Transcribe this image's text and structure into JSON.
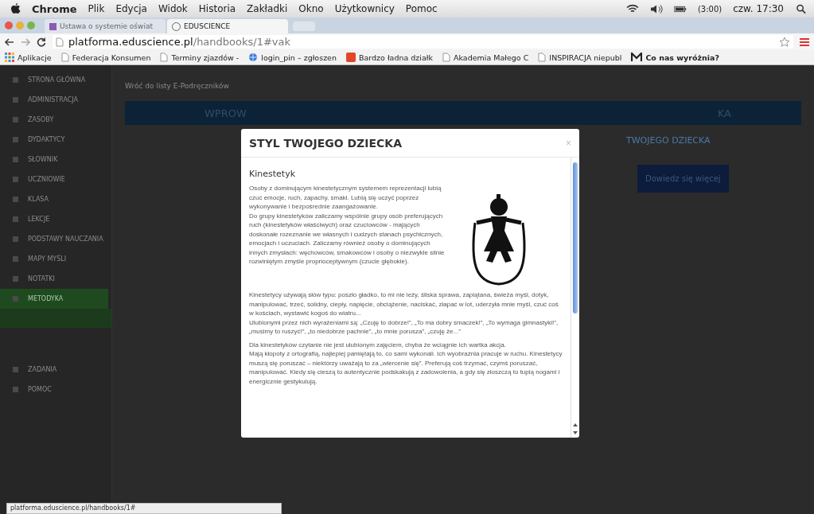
{
  "menu_bar": {
    "app": "Chrome",
    "items": [
      "Plik",
      "Edycja",
      "Widok",
      "Historia",
      "Zakładki",
      "Okno",
      "Użytkownicy",
      "Pomoc"
    ],
    "battery_time": "(3:00)",
    "clock": "czw. 17:30"
  },
  "tabs": [
    {
      "label": "Ustawa o systemie oświat",
      "selected": false
    },
    {
      "label": "EDUSCIENCE",
      "selected": true
    }
  ],
  "address_bar": {
    "host": "platforma.eduscience.pl",
    "path": "/handbooks/1#vak"
  },
  "bookmarks": [
    {
      "label": "Aplikacje",
      "kind": "apps"
    },
    {
      "label": "Federacja Konsumen",
      "kind": "page"
    },
    {
      "label": "Terminy zjazdów -",
      "kind": "page"
    },
    {
      "label": "login_pin – zgłoszen",
      "kind": "globe"
    },
    {
      "label": "Bardzo ładna działk",
      "kind": "flag"
    },
    {
      "label": "Akademia Małego C",
      "kind": "page"
    },
    {
      "label": "INSPIRACJA niepubl",
      "kind": "page"
    },
    {
      "label": "Co nas wyróżnia?",
      "kind": "logo"
    }
  ],
  "sidebar": {
    "items": [
      {
        "label": "STRONA GŁÓWNA",
        "selected": false
      },
      {
        "label": "ADMINISTRACJA",
        "selected": false
      },
      {
        "label": "ZASOBY",
        "selected": false
      },
      {
        "label": "DYDAKTYCY",
        "selected": false
      },
      {
        "label": "SŁOWNIK",
        "selected": false
      },
      {
        "label": "UCZNIOWIE",
        "selected": false
      },
      {
        "label": "KLASA",
        "selected": false
      },
      {
        "label": "LEKCJE",
        "selected": false
      },
      {
        "label": "PODSTAWY NAUCZANIA",
        "selected": false
      },
      {
        "label": "MAPY MYŚLI",
        "selected": false
      },
      {
        "label": "NOTATKI",
        "selected": false
      },
      {
        "label": "METODYKA",
        "selected": true
      }
    ],
    "bottom_items": [
      {
        "label": "ZADANIA"
      },
      {
        "label": "POMOC"
      }
    ]
  },
  "page": {
    "back_link": "Wróć do listy E-Podręczników",
    "banner_left": "WPROW",
    "banner_right": "KA",
    "side_heading": "TWOJEGO DZIECKA",
    "more_button": "Dowiedz się więcej"
  },
  "modal": {
    "title": "STYL TWOJEGO DZIECKA",
    "close": "×",
    "heading": "Kinestetyk",
    "intro": [
      "Osoby z dominującym kinestetycznym systemem reprezentacji lubią czuć emocje, ruch, zapachy, smaki. Lubią się uczyć poprzez wykonywanie i bezpośrednie zaangażowanie.",
      "Do grupy kinestetyków zaliczamy wspólnie grupy osób preferujących ruch (kinestetyków właściwych) oraz czuciowców - mających doskonałe rozeznanie we własnych i cudzych stanach psychicznych, emocjach i uczuciach. Zaliczamy również osoby o dominujących innych zmysłach: węchowców, smakowców i osoby o niezwykle silnie rozwiniętym zmyśle proprioceptywnym (czucie głębokie)."
    ],
    "paragraphs": [
      [
        "Kinestetycy używają słów typu: poszło gładko, to mi nie leży, śliska sprawa, zaplątana, świeża myśl, dotyk, manipulować, trzeć, solidny, ciepły, napięcie, obciążenie, naciskać, złapać w lot, uderzyła mnie myśl, czuć coś w kościach, wystawić kogoś do wiatru...",
        "Ulubionymi przez nich wyrażeniami są: „Czuję to dobrze!”, „To ma dobry smaczek!”, „To wymaga gimnastyki!”, „musimy to ruszyć!”, „to niedobrze pachnie”, „to mnie porusza”, „czuję że...”"
      ],
      [
        "Dla kinestetyków czytanie nie jest ulubionym zajęciem, chyba że wciągnie ich wartka akcja.",
        "Mają kłopoty z ortografią, najlepiej pamiętają to, co sami wykonali. Ich wyobraźnia pracuje w ruchu. Kinestetycy muszą się poruszać – niektórzy uważają to za „wiercenie się”. Preferują coś trzymać, czymś poruszać, manipulować. Kiedy się cieszą to autentycznie podskakują z zadowolenia, a gdy się złoszczą to tupią nogami i energicznie gestykulują."
      ]
    ]
  },
  "status_url": "platforma.eduscience.pl/handbooks/1#"
}
